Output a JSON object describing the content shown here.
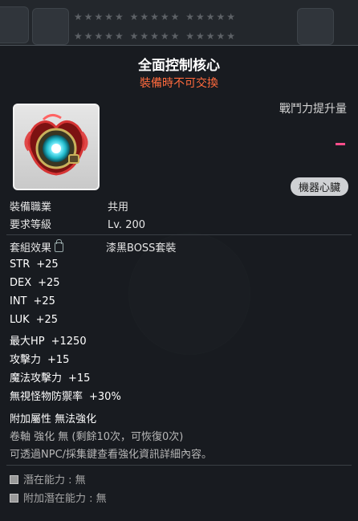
{
  "background": {
    "star_rows": [
      "★★★★★ ★★★★★ ★★★★★",
      "★★★★★ ★★★★★ ★★★★★"
    ]
  },
  "item": {
    "name": "全面控制核心",
    "trade_note": "裝備時不可交換",
    "icon": "control-core-heart-icon",
    "power_label": "戰鬥力提升量",
    "category_badge": "機器心臟"
  },
  "requirements": [
    {
      "key": "裝備職業",
      "value": "共用"
    },
    {
      "key": "要求等級",
      "value": "Lv. 200"
    }
  ],
  "set_effect": {
    "label": "套組效果",
    "icon": "lock-icon",
    "name": "漆黑BOSS套裝"
  },
  "stats": [
    {
      "name": "STR",
      "value": "+25"
    },
    {
      "name": "DEX",
      "value": "+25"
    },
    {
      "name": "INT",
      "value": "+25"
    },
    {
      "name": "LUK",
      "value": "+25"
    },
    {
      "name": "最大HP",
      "value": "+1250"
    },
    {
      "name": "攻擊力",
      "value": "+15"
    },
    {
      "name": "魔法攻擊力",
      "value": "+15"
    },
    {
      "name": "無視怪物防禦率",
      "value": "+30%"
    }
  ],
  "extra_attribute": "附加屬性 無法強化",
  "scroll_line": "卷軸 強化 無 (剩餘10次，可恢復0次)",
  "npc_hint": "可透過NPC/採集鍵查看強化資訊詳細內容。",
  "potential": {
    "label": "潛在能力",
    "value": "無"
  },
  "additional_potential": {
    "label": "附加潛在能力",
    "value": "無"
  },
  "colors": {
    "title": "#ffffff",
    "warning": "#ff6a3d",
    "power_mark": "#ff4d8a"
  }
}
